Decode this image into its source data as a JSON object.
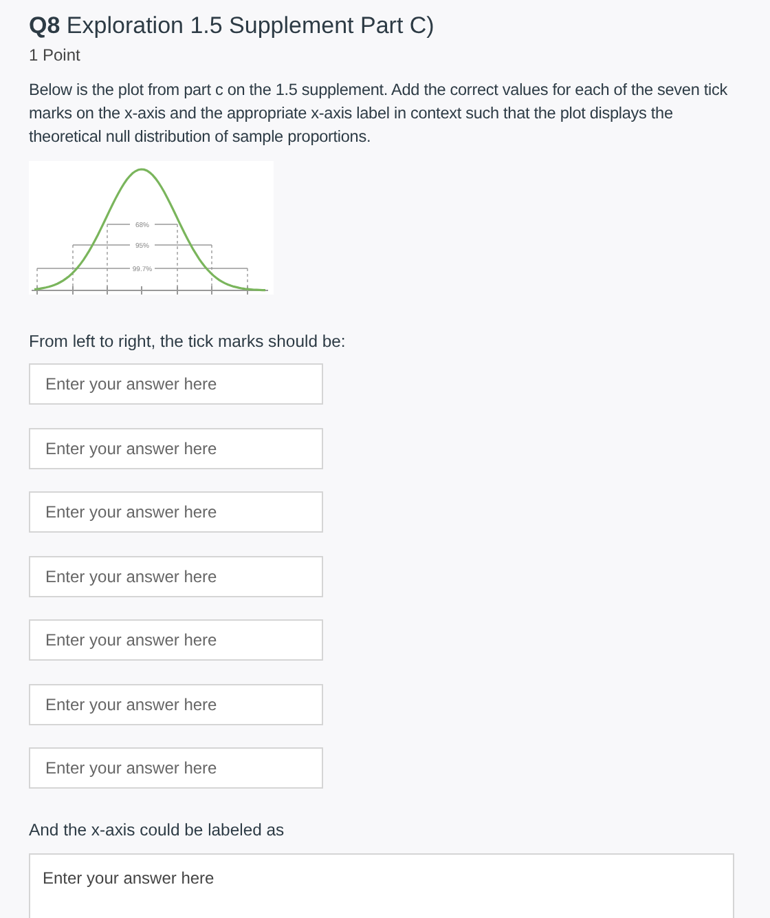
{
  "question": {
    "number": "Q8",
    "title": "Exploration 1.5 Supplement Part C)",
    "points": "1 Point",
    "prompt": "Below is the plot from part c on the 1.5 supplement. Add the correct values for each of the seven tick marks on the x-axis and the appropriate x-axis label in context such that the plot displays the theoretical null distribution of sample proportions."
  },
  "figure": {
    "intervals": [
      "68%",
      "95%",
      "99.7%"
    ]
  },
  "tick_prompt": "From left to right, the tick marks should be:",
  "tick_fields": [
    {
      "placeholder": "Enter your answer here"
    },
    {
      "placeholder": "Enter your answer here"
    },
    {
      "placeholder": "Enter your answer here"
    },
    {
      "placeholder": "Enter your answer here"
    },
    {
      "placeholder": "Enter your answer here"
    },
    {
      "placeholder": "Enter your answer here"
    },
    {
      "placeholder": "Enter your answer here"
    }
  ],
  "label_prompt": "And the x-axis could be labeled as",
  "label_field": {
    "placeholder": "Enter your answer here"
  }
}
